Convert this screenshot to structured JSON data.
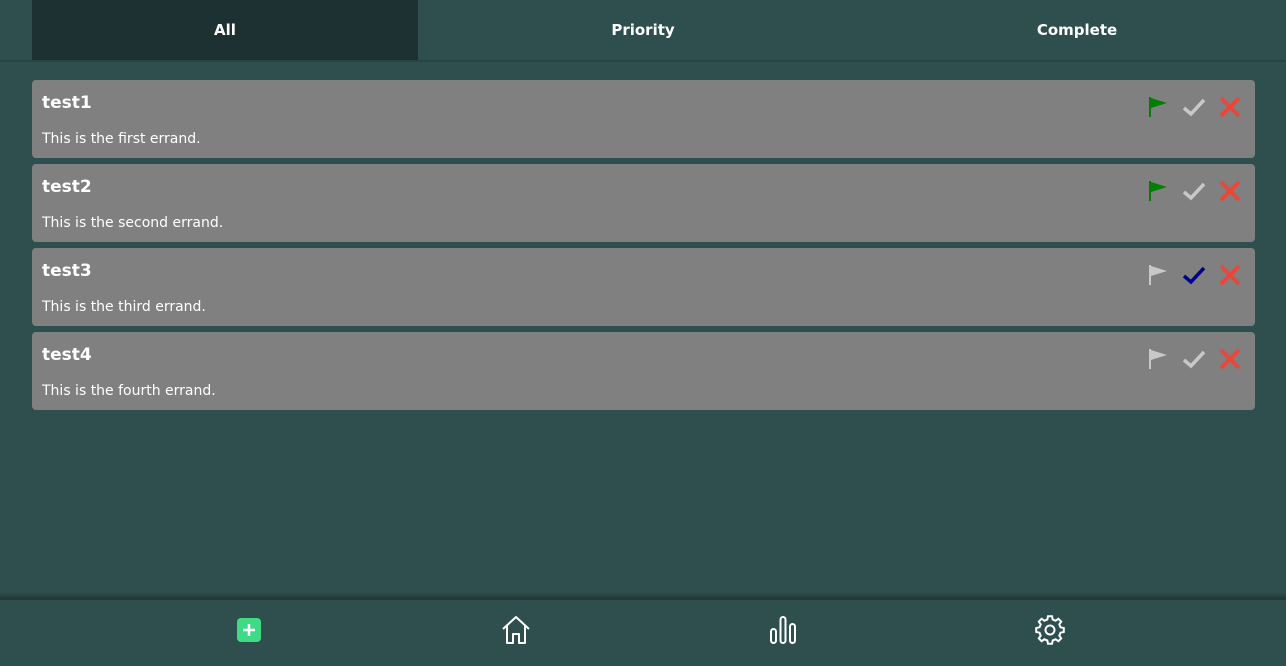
{
  "tabs": [
    {
      "label": "All",
      "active": true
    },
    {
      "label": "Priority",
      "active": false
    },
    {
      "label": "Complete",
      "active": false
    }
  ],
  "errands": [
    {
      "title": "test1",
      "description": "This is the first errand.",
      "priority": true,
      "complete": false
    },
    {
      "title": "test2",
      "description": "This is the second errand.",
      "priority": true,
      "complete": false
    },
    {
      "title": "test3",
      "description": "This is the third errand.",
      "priority": false,
      "complete": true
    },
    {
      "title": "test4",
      "description": "This is the fourth errand.",
      "priority": false,
      "complete": false
    }
  ],
  "icons": {
    "flag": "flag-icon",
    "check": "check-icon",
    "delete": "close-icon",
    "add": "plus-square-icon",
    "home": "home-icon",
    "stats": "bar-chart-icon",
    "settings": "gear-icon"
  },
  "colors": {
    "background": "#2f4f4f",
    "active_tab": "#1e3132",
    "card": "#808080",
    "flag_on": "#008000",
    "flag_off": "#c8c8c8",
    "check_on": "#00008b",
    "check_off": "#c8c8c8",
    "delete": "#e8473a",
    "add_button": "#3ddc84"
  }
}
